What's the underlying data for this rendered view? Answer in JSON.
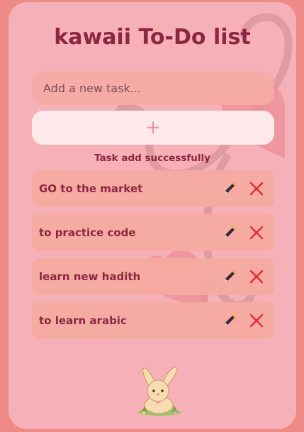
{
  "app": {
    "title": "kawaii To-Do list"
  },
  "input": {
    "value": "",
    "placeholder": "Add a new task..."
  },
  "add_button": {
    "label": "+"
  },
  "status_message": "Task add successfully",
  "tasks": [
    {
      "text": "GO to the market"
    },
    {
      "text": "to practice code"
    },
    {
      "text": "learn new hadith"
    },
    {
      "text": "to learn arabic"
    }
  ],
  "icons": {
    "edit": "pen-icon",
    "delete": "close-x-icon",
    "mascot": "bunny-icon"
  },
  "colors": {
    "page_background": "#ef8a87",
    "card_background": "#f6b0b7",
    "title_text": "#8b2741",
    "task_background": "#f5aaa0",
    "delete": "#e0303c",
    "add_button_background": "#fde8ea",
    "add_button_plus": "#f08ca8"
  }
}
